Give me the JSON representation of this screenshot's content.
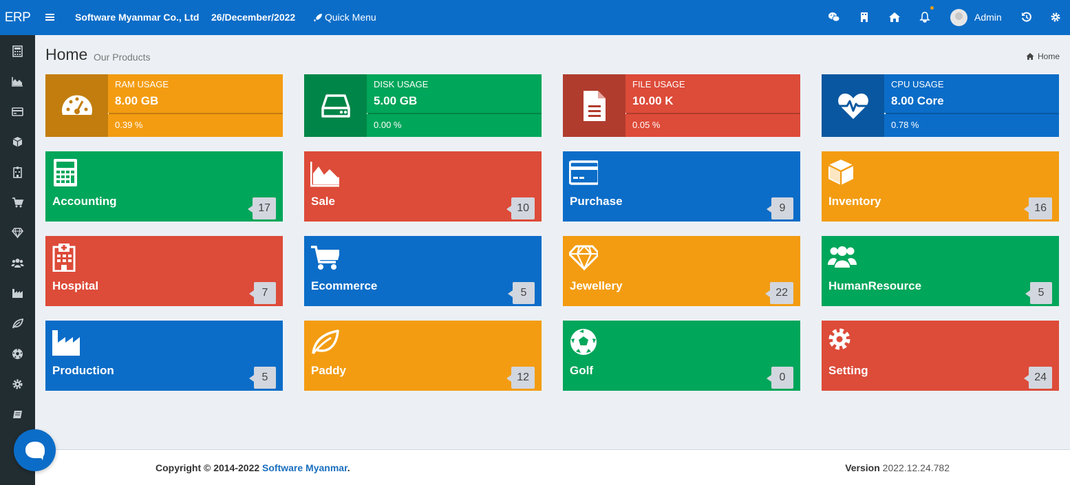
{
  "header": {
    "logo": "ERP",
    "company": "Software Myanmar Co., Ltd",
    "date": "26/December/2022",
    "quick_menu": "Quick Menu",
    "user": "Admin"
  },
  "page": {
    "title": "Home",
    "subtitle": "Our Products",
    "breadcrumb": "Home"
  },
  "usage": [
    {
      "label": "RAM USAGE",
      "value": "8.00 GB",
      "percent": "0.39 %",
      "fraction": 0.0039,
      "icon": "dashboard-icon",
      "color": "#f39c12"
    },
    {
      "label": "DISK USAGE",
      "value": "5.00 GB",
      "percent": "0.00 %",
      "fraction": 0.0,
      "icon": "hdd-icon",
      "color": "#00a65a"
    },
    {
      "label": "FILE USAGE",
      "value": "10.00 K",
      "percent": "0.05 %",
      "fraction": 0.0005,
      "icon": "file-icon",
      "color": "#dd4b39"
    },
    {
      "label": "CPU USAGE",
      "value": "8.00 Core",
      "percent": "0.78 %",
      "fraction": 0.0078,
      "icon": "heartbeat-icon",
      "color": "#0b6dc8"
    }
  ],
  "modules": [
    {
      "label": "Accounting",
      "count": "17",
      "icon": "calculator-icon",
      "color": "#00a65a"
    },
    {
      "label": "Sale",
      "count": "10",
      "icon": "area-chart-icon",
      "color": "#dd4b39"
    },
    {
      "label": "Purchase",
      "count": "9",
      "icon": "credit-card-icon",
      "color": "#0b6dc8"
    },
    {
      "label": "Inventory",
      "count": "16",
      "icon": "cube-icon",
      "color": "#f39c12"
    },
    {
      "label": "Hospital",
      "count": "7",
      "icon": "hospital-icon",
      "color": "#dd4b39"
    },
    {
      "label": "Ecommerce",
      "count": "5",
      "icon": "cart-icon",
      "color": "#0b6dc8"
    },
    {
      "label": "Jewellery",
      "count": "22",
      "icon": "diamond-icon",
      "color": "#f39c12"
    },
    {
      "label": "HumanResource",
      "count": "5",
      "icon": "users-icon",
      "color": "#00a65a"
    },
    {
      "label": "Production",
      "count": "5",
      "icon": "industry-icon",
      "color": "#0b6dc8"
    },
    {
      "label": "Paddy",
      "count": "12",
      "icon": "leaf-icon",
      "color": "#f39c12"
    },
    {
      "label": "Golf",
      "count": "0",
      "icon": "soccer-ball-icon",
      "color": "#00a65a"
    },
    {
      "label": "Setting",
      "count": "24",
      "icon": "gear-icon",
      "color": "#dd4b39"
    }
  ],
  "footer": {
    "copyright": "Copyright © 2014-2022 ",
    "company_link": "Software Myanmar",
    "period": ".",
    "version_label": "Version",
    "version": "2022.12.24.782"
  }
}
